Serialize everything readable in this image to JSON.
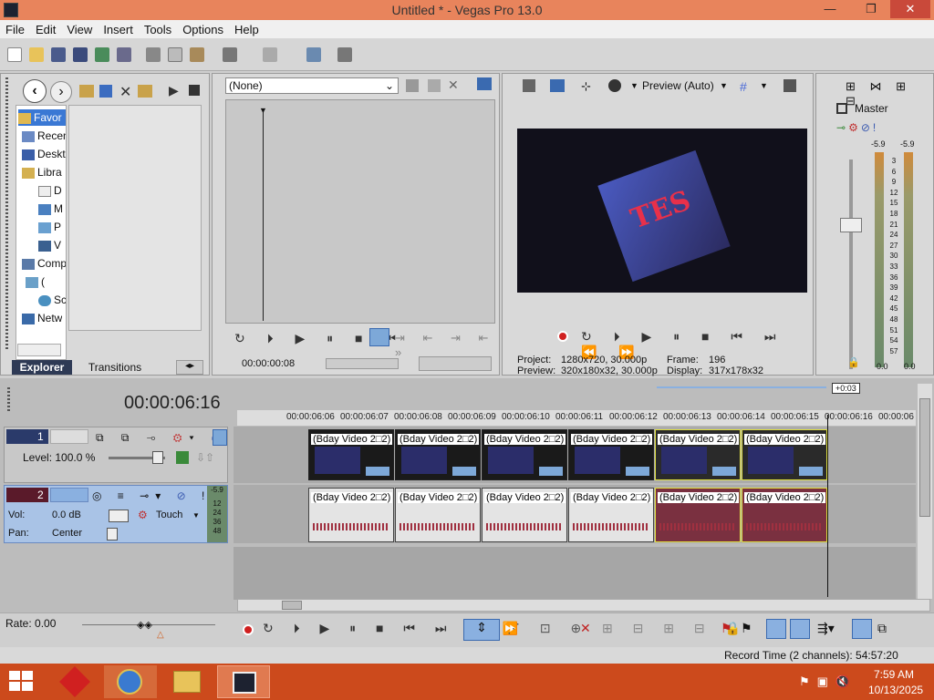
{
  "window": {
    "title": "Untitled * - Vegas Pro 13.0",
    "min": "—",
    "max": "❐",
    "close": "✕"
  },
  "menu": [
    "File",
    "Edit",
    "View",
    "Insert",
    "Tools",
    "Options",
    "Help"
  ],
  "explorer": {
    "items": [
      "Favor",
      "Recen",
      "Deskt",
      "Libra",
      "D",
      "M",
      "P",
      "V",
      "Comp",
      "(",
      "Sc",
      "Netw"
    ],
    "tabs": [
      "Explorer",
      "Transitions"
    ]
  },
  "trimmer": {
    "select_value": "(None)",
    "timecode": "00:00:00:08"
  },
  "preview": {
    "mode": "Preview (Auto)",
    "project_label": "Project:",
    "project_value": "1280x720, 30.000p",
    "preview_label": "Preview:",
    "preview_value": "320x180x32, 30.000p",
    "frame_label": "Frame:",
    "frame_value": "196",
    "display_label": "Display:",
    "display_value": "317x178x32"
  },
  "master": {
    "title": "Master",
    "peak_left": "-5.9",
    "peak_right": "-5.9",
    "scale": [
      "3",
      "6",
      "9",
      "12",
      "15",
      "18",
      "21",
      "24",
      "27",
      "30",
      "33",
      "36",
      "39",
      "42",
      "45",
      "48",
      "51",
      "54",
      "57"
    ],
    "bottom_left": "0.0",
    "bottom_right": "0.0"
  },
  "timeline": {
    "timecode": "00:00:06:16",
    "offset_badge": "+0:03",
    "ruler": [
      "00:00:06:06",
      "00:00:06:07",
      "00:00:06:08",
      "00:00:06:09",
      "00:00:06:10",
      "00:00:06:11",
      "00:00:06:12",
      "00:00:06:13",
      "00:00:06:14",
      "00:00:06:15",
      "00:00:06:16",
      "00:00:06"
    ],
    "video_track": {
      "number": "1",
      "level": "Level: 100.0 %"
    },
    "audio_track": {
      "number": "2",
      "vol_label": "Vol:",
      "vol_value": "0.0 dB",
      "pan_label": "Pan:",
      "pan_value": "Center",
      "automation": "Touch",
      "meter_top": "-5.9",
      "meter_scale": [
        "12",
        "24",
        "36",
        "48"
      ]
    },
    "clip_label": "(Bday Video 2□2)",
    "rate": "Rate: 0.00",
    "record_time": "Record Time (2 channels): 54:57:20"
  },
  "taskbar": {
    "time": "7:59 AM",
    "date": "10/13/2025"
  },
  "colors": {
    "title_bar": "#e8845c",
    "close": "#c9493a",
    "taskbar": "#cc4a1c",
    "track_blue": "#a9c3e6"
  }
}
